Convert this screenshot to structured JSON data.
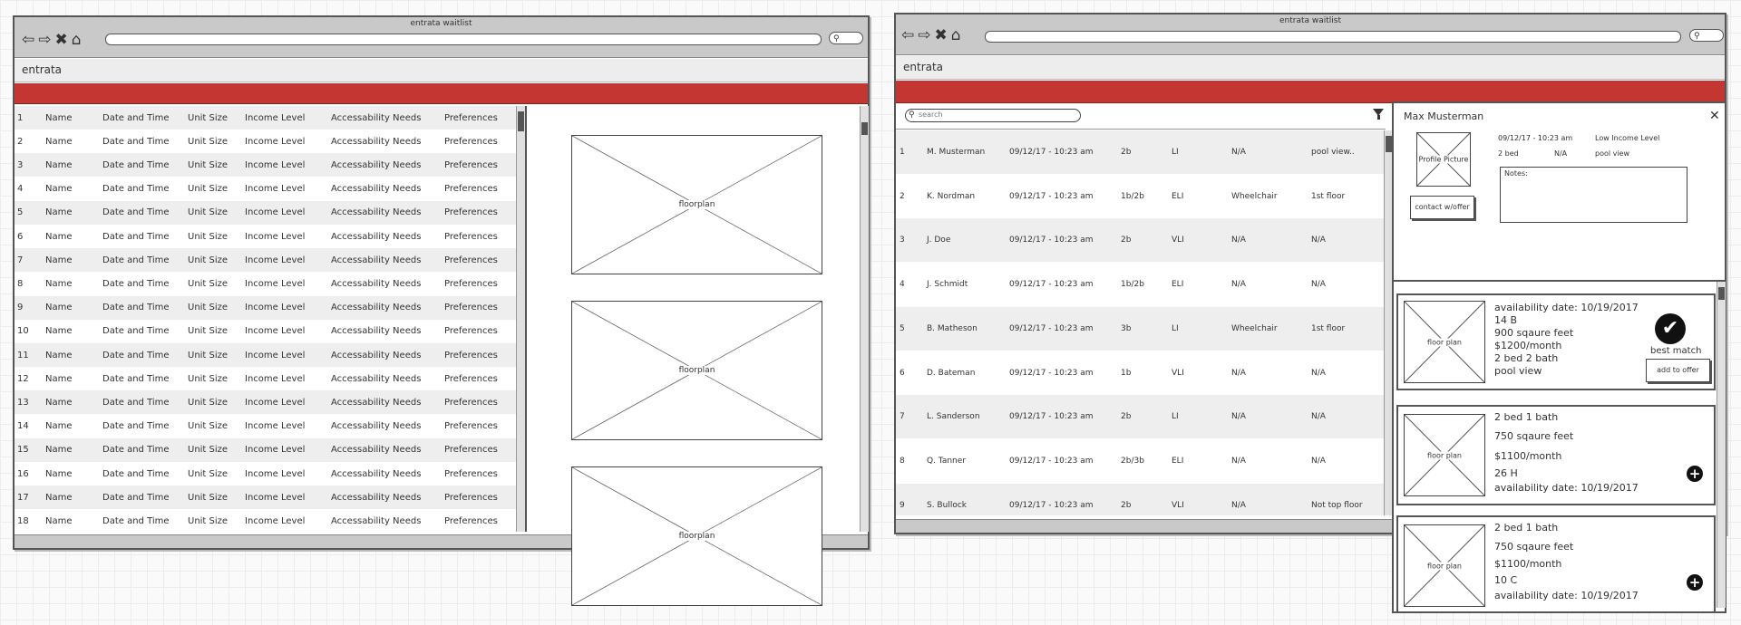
{
  "left_window": {
    "title": "entrata waitlist",
    "brand": "entrata",
    "columns": [
      "Name",
      "Date and Time",
      "Unit Size",
      "Income Level",
      "Accessability Needs",
      "Preferences"
    ],
    "row_numbers": [
      "1",
      "2",
      "3",
      "4",
      "5",
      "6",
      "7",
      "8",
      "9",
      "10",
      "11",
      "12",
      "13",
      "14",
      "15",
      "16",
      "17",
      "18"
    ],
    "floorplan_label": "floorplan"
  },
  "right_window": {
    "title": "entrata waitlist",
    "brand": "entrata",
    "search_placeholder": "search",
    "rows": [
      {
        "num": "1",
        "name": "M. Musterman",
        "datetime": "09/12/17 - 10:23 am",
        "unit": "2b",
        "income": "LI",
        "needs": "N/A",
        "pref": "pool view.."
      },
      {
        "num": "2",
        "name": "K. Nordman",
        "datetime": "09/12/17 - 10:23 am",
        "unit": "1b/2b",
        "income": "ELI",
        "needs": "Wheelchair",
        "pref": "1st floor"
      },
      {
        "num": "3",
        "name": "J. Doe",
        "datetime": "09/12/17 - 10:23 am",
        "unit": "2b",
        "income": "VLI",
        "needs": "N/A",
        "pref": "N/A"
      },
      {
        "num": "4",
        "name": "J. Schmidt",
        "datetime": "09/12/17 - 10:23 am",
        "unit": "1b/2b",
        "income": "ELI",
        "needs": "N/A",
        "pref": "N/A"
      },
      {
        "num": "5",
        "name": "B. Matheson",
        "datetime": "09/12/17 - 10:23 am",
        "unit": "3b",
        "income": "LI",
        "needs": "Wheelchair",
        "pref": "1st floor"
      },
      {
        "num": "6",
        "name": "D. Bateman",
        "datetime": "09/12/17 - 10:23 am",
        "unit": "1b",
        "income": "VLI",
        "needs": "N/A",
        "pref": "N/A"
      },
      {
        "num": "7",
        "name": "L. Sanderson",
        "datetime": "09/12/17 - 10:23 am",
        "unit": "2b",
        "income": "LI",
        "needs": "N/A",
        "pref": "N/A"
      },
      {
        "num": "8",
        "name": "Q. Tanner",
        "datetime": "09/12/17 - 10:23 am",
        "unit": "2b/3b",
        "income": "ELI",
        "needs": "N/A",
        "pref": "N/A"
      },
      {
        "num": "9",
        "name": "S. Bullock",
        "datetime": "09/12/17 - 10:23 am",
        "unit": "2b",
        "income": "VLI",
        "needs": "N/A",
        "pref": "Not top floor"
      }
    ]
  },
  "detail": {
    "name": "Max Musterman",
    "close": "✕",
    "profile_label": "Profile Picture",
    "datetime": "09/12/17 - 10:23 am",
    "income_level": "Low Income Level",
    "bed": "2 bed",
    "needs": "N/A",
    "pref": "pool view",
    "contact_button": "contact w/offer",
    "notes_label": "Notes:",
    "floorplan_label": "floor plan",
    "cards": [
      {
        "lines": [
          "availability date: 10/19/2017",
          "14 B",
          "900 sqaure feet",
          "$1200/month",
          "2 bed 2 bath",
          "pool view"
        ],
        "badge": "best match",
        "button": "add to offer"
      },
      {
        "lines": [
          "2 bed 1 bath",
          "750 sqaure feet",
          "$1100/month",
          "26 H",
          "availability date: 10/19/2017"
        ]
      },
      {
        "lines": [
          "2 bed 1 bath",
          "750 sqaure feet",
          "$1100/month",
          "10 C",
          "availability date: 10/19/2017"
        ]
      }
    ]
  }
}
